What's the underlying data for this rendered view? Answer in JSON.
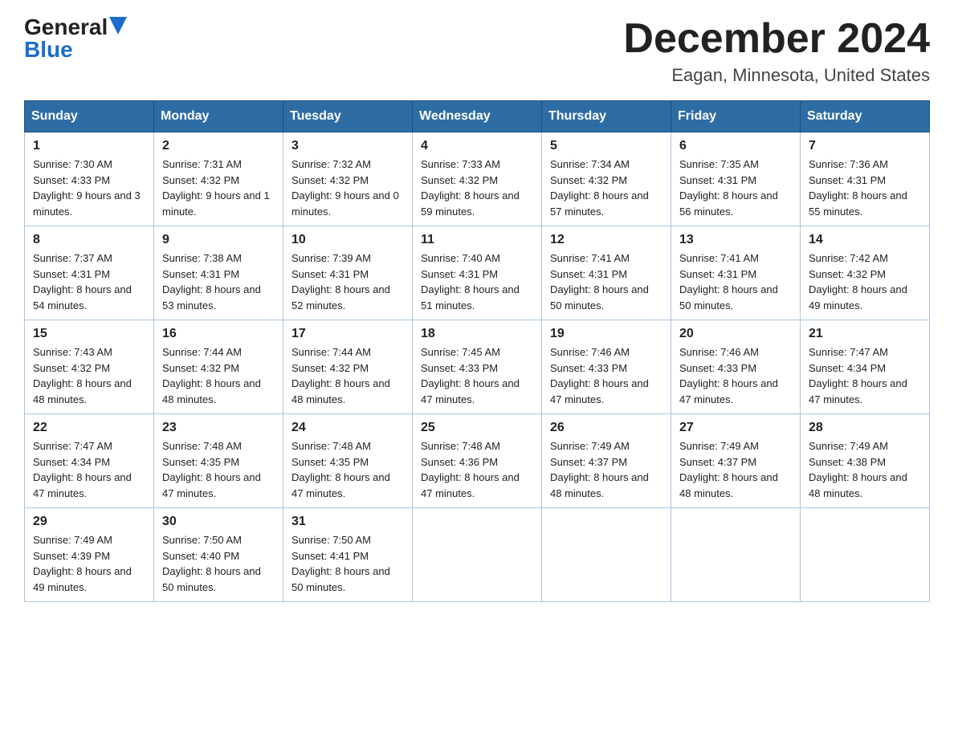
{
  "header": {
    "logo_general": "General",
    "logo_blue": "Blue",
    "month_title": "December 2024",
    "location": "Eagan, Minnesota, United States"
  },
  "days_of_week": [
    "Sunday",
    "Monday",
    "Tuesday",
    "Wednesday",
    "Thursday",
    "Friday",
    "Saturday"
  ],
  "weeks": [
    [
      {
        "day": "1",
        "sunrise": "7:30 AM",
        "sunset": "4:33 PM",
        "daylight": "9 hours and 3 minutes."
      },
      {
        "day": "2",
        "sunrise": "7:31 AM",
        "sunset": "4:32 PM",
        "daylight": "9 hours and 1 minute."
      },
      {
        "day": "3",
        "sunrise": "7:32 AM",
        "sunset": "4:32 PM",
        "daylight": "9 hours and 0 minutes."
      },
      {
        "day": "4",
        "sunrise": "7:33 AM",
        "sunset": "4:32 PM",
        "daylight": "8 hours and 59 minutes."
      },
      {
        "day": "5",
        "sunrise": "7:34 AM",
        "sunset": "4:32 PM",
        "daylight": "8 hours and 57 minutes."
      },
      {
        "day": "6",
        "sunrise": "7:35 AM",
        "sunset": "4:31 PM",
        "daylight": "8 hours and 56 minutes."
      },
      {
        "day": "7",
        "sunrise": "7:36 AM",
        "sunset": "4:31 PM",
        "daylight": "8 hours and 55 minutes."
      }
    ],
    [
      {
        "day": "8",
        "sunrise": "7:37 AM",
        "sunset": "4:31 PM",
        "daylight": "8 hours and 54 minutes."
      },
      {
        "day": "9",
        "sunrise": "7:38 AM",
        "sunset": "4:31 PM",
        "daylight": "8 hours and 53 minutes."
      },
      {
        "day": "10",
        "sunrise": "7:39 AM",
        "sunset": "4:31 PM",
        "daylight": "8 hours and 52 minutes."
      },
      {
        "day": "11",
        "sunrise": "7:40 AM",
        "sunset": "4:31 PM",
        "daylight": "8 hours and 51 minutes."
      },
      {
        "day": "12",
        "sunrise": "7:41 AM",
        "sunset": "4:31 PM",
        "daylight": "8 hours and 50 minutes."
      },
      {
        "day": "13",
        "sunrise": "7:41 AM",
        "sunset": "4:31 PM",
        "daylight": "8 hours and 50 minutes."
      },
      {
        "day": "14",
        "sunrise": "7:42 AM",
        "sunset": "4:32 PM",
        "daylight": "8 hours and 49 minutes."
      }
    ],
    [
      {
        "day": "15",
        "sunrise": "7:43 AM",
        "sunset": "4:32 PM",
        "daylight": "8 hours and 48 minutes."
      },
      {
        "day": "16",
        "sunrise": "7:44 AM",
        "sunset": "4:32 PM",
        "daylight": "8 hours and 48 minutes."
      },
      {
        "day": "17",
        "sunrise": "7:44 AM",
        "sunset": "4:32 PM",
        "daylight": "8 hours and 48 minutes."
      },
      {
        "day": "18",
        "sunrise": "7:45 AM",
        "sunset": "4:33 PM",
        "daylight": "8 hours and 47 minutes."
      },
      {
        "day": "19",
        "sunrise": "7:46 AM",
        "sunset": "4:33 PM",
        "daylight": "8 hours and 47 minutes."
      },
      {
        "day": "20",
        "sunrise": "7:46 AM",
        "sunset": "4:33 PM",
        "daylight": "8 hours and 47 minutes."
      },
      {
        "day": "21",
        "sunrise": "7:47 AM",
        "sunset": "4:34 PM",
        "daylight": "8 hours and 47 minutes."
      }
    ],
    [
      {
        "day": "22",
        "sunrise": "7:47 AM",
        "sunset": "4:34 PM",
        "daylight": "8 hours and 47 minutes."
      },
      {
        "day": "23",
        "sunrise": "7:48 AM",
        "sunset": "4:35 PM",
        "daylight": "8 hours and 47 minutes."
      },
      {
        "day": "24",
        "sunrise": "7:48 AM",
        "sunset": "4:35 PM",
        "daylight": "8 hours and 47 minutes."
      },
      {
        "day": "25",
        "sunrise": "7:48 AM",
        "sunset": "4:36 PM",
        "daylight": "8 hours and 47 minutes."
      },
      {
        "day": "26",
        "sunrise": "7:49 AM",
        "sunset": "4:37 PM",
        "daylight": "8 hours and 48 minutes."
      },
      {
        "day": "27",
        "sunrise": "7:49 AM",
        "sunset": "4:37 PM",
        "daylight": "8 hours and 48 minutes."
      },
      {
        "day": "28",
        "sunrise": "7:49 AM",
        "sunset": "4:38 PM",
        "daylight": "8 hours and 48 minutes."
      }
    ],
    [
      {
        "day": "29",
        "sunrise": "7:49 AM",
        "sunset": "4:39 PM",
        "daylight": "8 hours and 49 minutes."
      },
      {
        "day": "30",
        "sunrise": "7:50 AM",
        "sunset": "4:40 PM",
        "daylight": "8 hours and 50 minutes."
      },
      {
        "day": "31",
        "sunrise": "7:50 AM",
        "sunset": "4:41 PM",
        "daylight": "8 hours and 50 minutes."
      },
      null,
      null,
      null,
      null
    ]
  ],
  "labels": {
    "sunrise_prefix": "Sunrise: ",
    "sunset_prefix": "Sunset: ",
    "daylight_prefix": "Daylight: "
  }
}
